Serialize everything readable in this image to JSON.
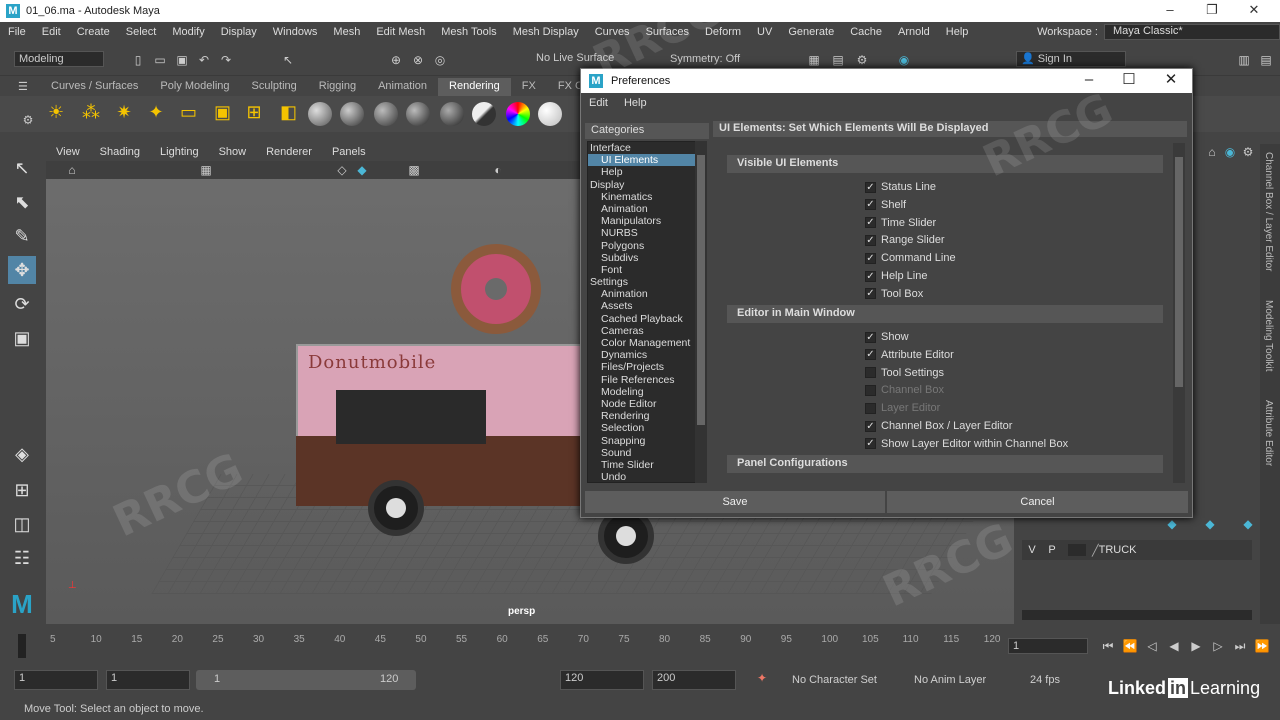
{
  "title_bar": {
    "title": "01_06.ma - Autodesk Maya"
  },
  "menubar": {
    "items": [
      "File",
      "Edit",
      "Create",
      "Select",
      "Modify",
      "Display",
      "Windows",
      "Mesh",
      "Edit Mesh",
      "Mesh Tools",
      "Mesh Display",
      "Curves",
      "Surfaces",
      "Deform",
      "UV",
      "Generate",
      "Cache",
      "Arnold",
      "Help"
    ],
    "workspace_label": "Workspace :",
    "workspace_value": "Maya Classic*"
  },
  "status_line": {
    "mode": "Modeling",
    "live_surface": "No Live Surface",
    "symmetry": "Symmetry: Off",
    "sign_in": "Sign In"
  },
  "shelf_tabs": [
    "Curves / Surfaces",
    "Poly Modeling",
    "Sculpting",
    "Rigging",
    "Animation",
    "Rendering",
    "FX",
    "FX Ca"
  ],
  "shelf_active_tab": "Rendering",
  "viewport": {
    "menu": [
      "View",
      "Shading",
      "Lighting",
      "Show",
      "Renderer",
      "Panels"
    ],
    "camera_label": "persp",
    "truck_text": "Donutmobile"
  },
  "layer_editor": {
    "v": "V",
    "p": "P",
    "layer_name": "TRUCK"
  },
  "right_tabs": [
    "Channel Box / Layer Editor",
    "Modeling Toolkit",
    "Attribute Editor"
  ],
  "time_slider": {
    "ticks": [
      "5",
      "10",
      "15",
      "20",
      "25",
      "30",
      "35",
      "40",
      "45",
      "50",
      "55",
      "60",
      "65",
      "70",
      "75",
      "80",
      "85",
      "90",
      "95",
      "100",
      "105",
      "110",
      "115",
      "120"
    ],
    "current": "1"
  },
  "range_slider": {
    "start": "1",
    "playback_start": "1",
    "range_start": "1",
    "range_end": "120",
    "playback_end": "120",
    "end": "200",
    "char_set": "No Character Set",
    "anim_layer": "No Anim Layer",
    "fps": "24 fps"
  },
  "help_line": "Move Tool: Select an object to move.",
  "branding": {
    "linkedin": "Linked",
    "in": "in",
    "learning": "Learning"
  },
  "preferences": {
    "title": "Preferences",
    "menu": [
      "Edit",
      "Help"
    ],
    "categories_label": "Categories",
    "categories": [
      {
        "label": "Interface",
        "level": 0
      },
      {
        "label": "UI Elements",
        "level": 1,
        "selected": true
      },
      {
        "label": "Help",
        "level": 1
      },
      {
        "label": "Display",
        "level": 0
      },
      {
        "label": "Kinematics",
        "level": 1
      },
      {
        "label": "Animation",
        "level": 1
      },
      {
        "label": "Manipulators",
        "level": 1
      },
      {
        "label": "NURBS",
        "level": 1
      },
      {
        "label": "Polygons",
        "level": 1
      },
      {
        "label": "Subdivs",
        "level": 1
      },
      {
        "label": "Font",
        "level": 1
      },
      {
        "label": "Settings",
        "level": 0
      },
      {
        "label": "Animation",
        "level": 1
      },
      {
        "label": "Assets",
        "level": 1
      },
      {
        "label": "Cached Playback",
        "level": 1
      },
      {
        "label": "Cameras",
        "level": 1
      },
      {
        "label": "Color Management",
        "level": 1
      },
      {
        "label": "Dynamics",
        "level": 1
      },
      {
        "label": "Files/Projects",
        "level": 1
      },
      {
        "label": "File References",
        "level": 1
      },
      {
        "label": "Modeling",
        "level": 1
      },
      {
        "label": "Node Editor",
        "level": 1
      },
      {
        "label": "Rendering",
        "level": 1
      },
      {
        "label": "Selection",
        "level": 1
      },
      {
        "label": "Snapping",
        "level": 1
      },
      {
        "label": "Sound",
        "level": 1
      },
      {
        "label": "Time Slider",
        "level": 1
      },
      {
        "label": "Undo",
        "level": 1
      }
    ],
    "panel_title": "UI Elements: Set Which Elements Will Be Displayed",
    "sections": {
      "visible": {
        "title": "Visible UI Elements",
        "items": [
          {
            "label": "Status Line",
            "checked": true
          },
          {
            "label": "Shelf",
            "checked": true
          },
          {
            "label": "Time Slider",
            "checked": true
          },
          {
            "label": "Range Slider",
            "checked": true
          },
          {
            "label": "Command Line",
            "checked": true
          },
          {
            "label": "Help Line",
            "checked": true
          },
          {
            "label": "Tool Box",
            "checked": true
          }
        ]
      },
      "editor": {
        "title": "Editor in Main Window",
        "items": [
          {
            "label": "Show",
            "checked": true
          },
          {
            "label": "Attribute Editor",
            "checked": true
          },
          {
            "label": "Tool Settings",
            "checked": false
          },
          {
            "label": "Channel Box",
            "checked": false,
            "disabled": true
          },
          {
            "label": "Layer Editor",
            "checked": false,
            "disabled": true
          },
          {
            "label": "Channel Box / Layer Editor",
            "checked": true
          },
          {
            "label": "Show Layer Editor within Channel Box",
            "checked": true
          }
        ]
      },
      "panel": {
        "title": "Panel Configurations"
      }
    },
    "save_label": "Save",
    "cancel_label": "Cancel"
  },
  "watermark": "RRCG"
}
